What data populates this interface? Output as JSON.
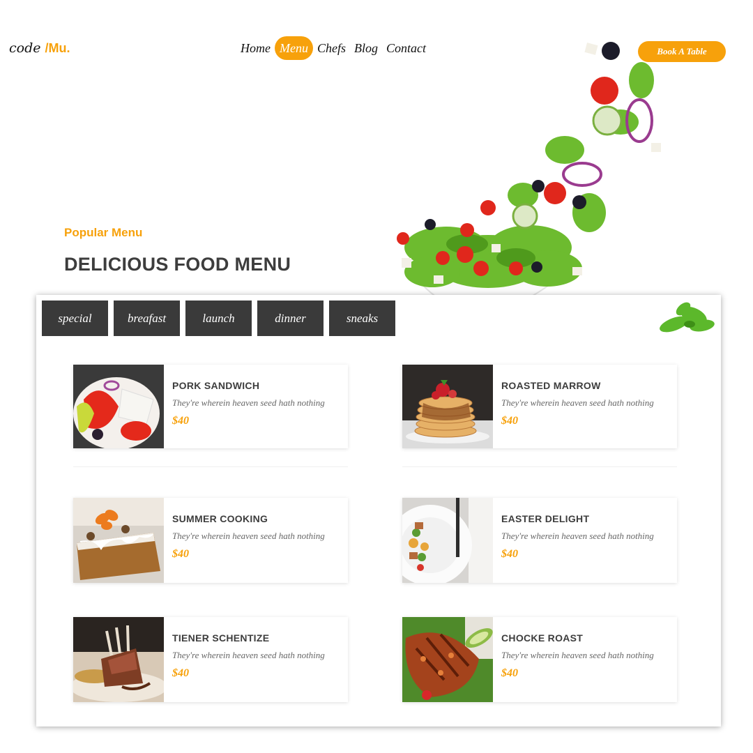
{
  "brand": {
    "logo_main": "code",
    "logo_accent": "/Mu.",
    "accent_color": "#f7a10b"
  },
  "nav": {
    "items": [
      {
        "label": "Home",
        "active": false
      },
      {
        "label": "Menu",
        "active": true
      },
      {
        "label": "Chefs",
        "active": false
      },
      {
        "label": "Blog",
        "active": false
      },
      {
        "label": "Contact",
        "active": false
      }
    ],
    "cta_label": "Book A Table"
  },
  "hero": {
    "eyebrow": "Popular Menu",
    "title": "DELICIOUS FOOD MENU"
  },
  "menu": {
    "tabs": [
      "special",
      "breafast",
      "launch",
      "dinner",
      "sneaks"
    ],
    "items": [
      {
        "name": "PORK SANDWICH",
        "description": "They're wherein heaven seed hath nothing",
        "price": "$40",
        "photo": "greek-salad"
      },
      {
        "name": "ROASTED MARROW",
        "description": "They're wherein heaven seed hath nothing",
        "price": "$40",
        "photo": "pancakes"
      },
      {
        "name": "SUMMER COOKING",
        "description": "They're wherein heaven seed hath nothing",
        "price": "$40",
        "photo": "carrot-cake"
      },
      {
        "name": "EASTER DELIGHT",
        "description": "They're wherein heaven seed hath nothing",
        "price": "$40",
        "photo": "plated-dish"
      },
      {
        "name": "TIENER SCHENTIZE",
        "description": "They're wherein heaven seed hath nothing",
        "price": "$40",
        "photo": "rack-of-lamb"
      },
      {
        "name": "CHOCKE ROAST",
        "description": "They're wherein heaven seed hath nothing",
        "price": "$40",
        "photo": "grilled-chicken"
      }
    ]
  }
}
